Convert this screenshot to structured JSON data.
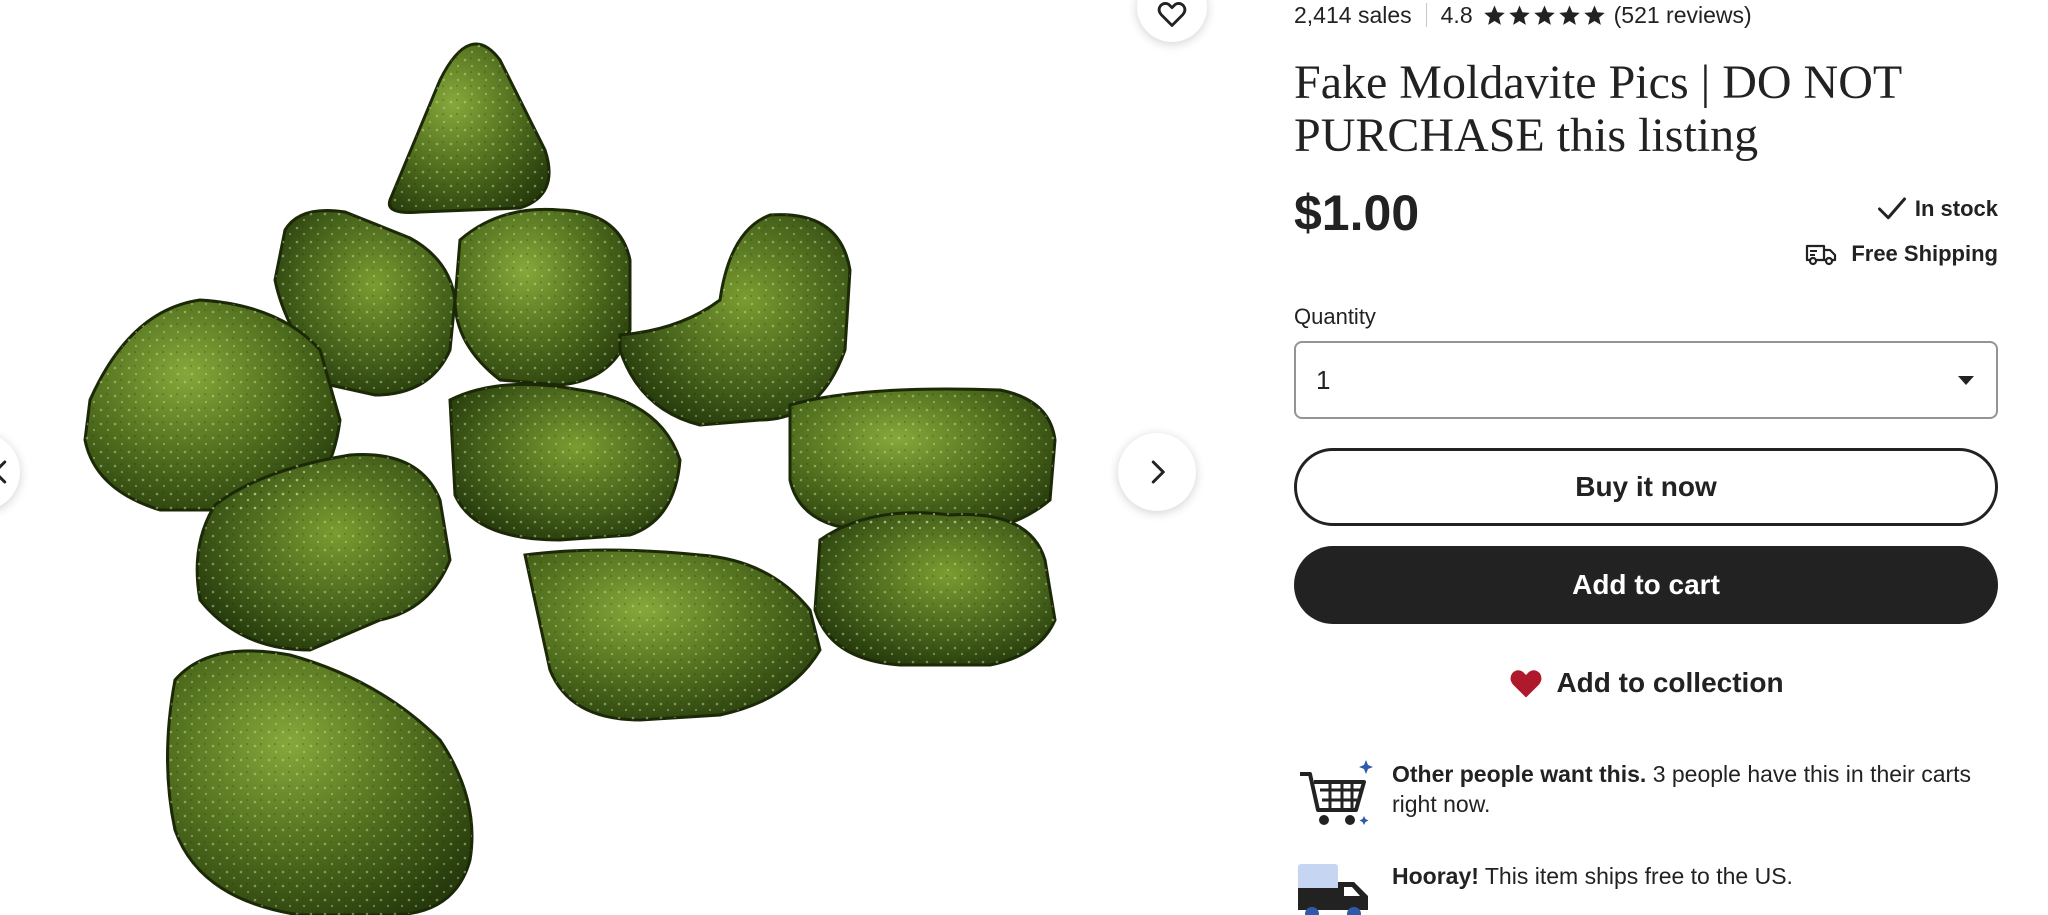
{
  "listing": {
    "sales": "2,414 sales",
    "rating": "4.8",
    "rating_stars": 4.8,
    "reviews": "(521 reviews)",
    "title": "Fake Moldavite Pics | DO NOT PURCHASE this listing",
    "price": "$1.00",
    "stock_status": "In stock",
    "shipping": "Free Shipping"
  },
  "quantity": {
    "label": "Quantity",
    "selected": "1"
  },
  "actions": {
    "buy_now": "Buy it now",
    "add_to_cart": "Add to cart",
    "add_to_collection": "Add to collection"
  },
  "promos": [
    {
      "bold": "Other people want this.",
      "text": " 3 people have this in their carts right now."
    },
    {
      "bold": "Hooray!",
      "text": " This item ships free to the US."
    }
  ],
  "gallery": {
    "icons": [
      "heart-icon",
      "chevron-right-icon",
      "chevron-left-icon"
    ]
  },
  "colors": {
    "text": "#222222",
    "button_dark": "#222222",
    "heart": "#b0192b",
    "stone_dark": "#2c3e14",
    "stone_light": "#6a8a2a"
  }
}
